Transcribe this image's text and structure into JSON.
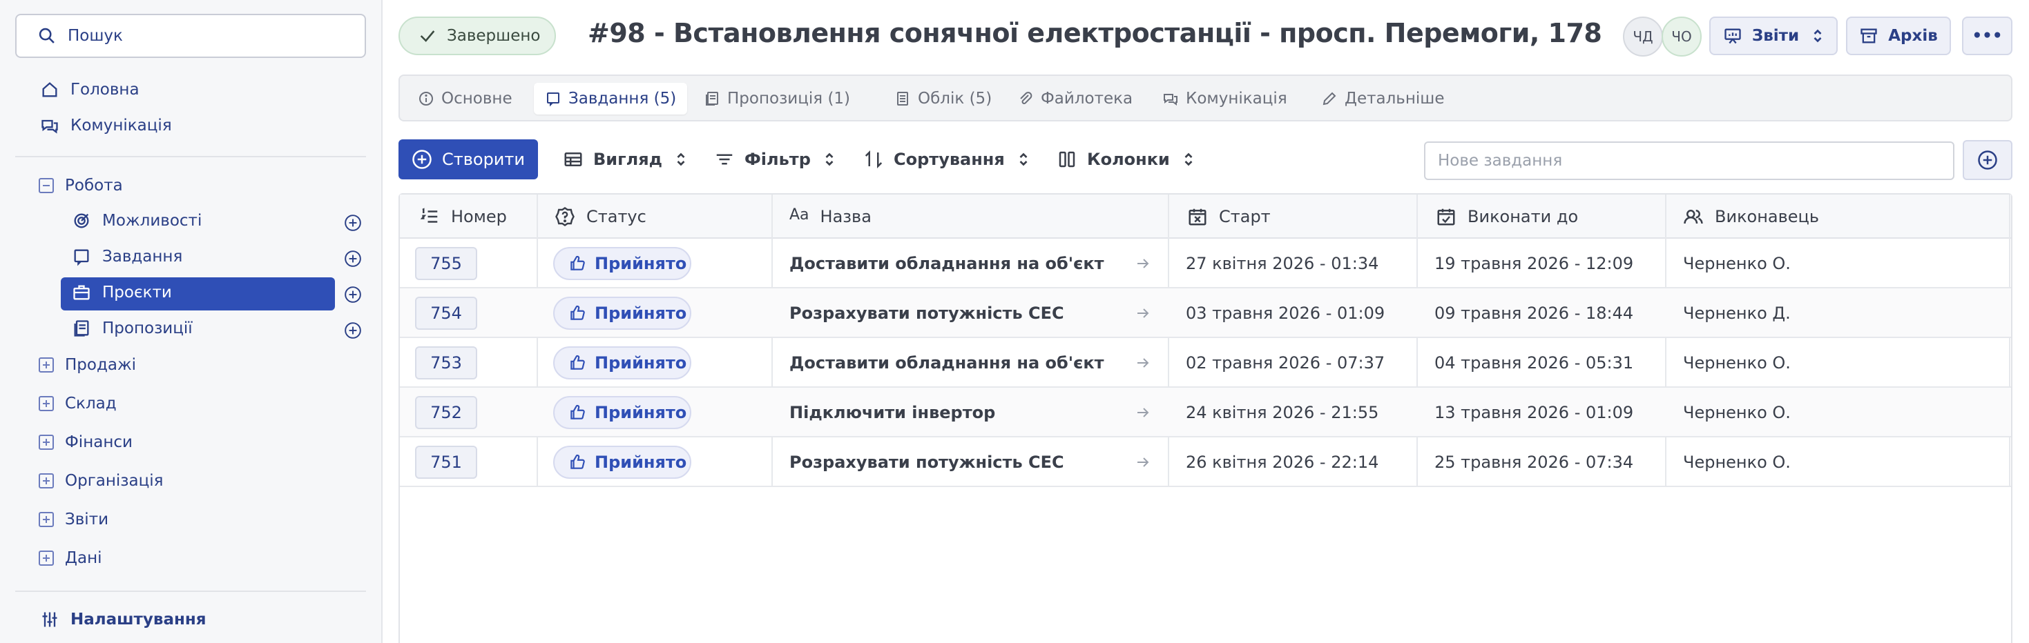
{
  "sidebar": {
    "search_label": "Пошук",
    "top_items": [
      {
        "label": "Головна",
        "icon": "home-icon"
      },
      {
        "label": "Комунікація",
        "icon": "chat-icon"
      }
    ],
    "work_group": {
      "label": "Робота",
      "items": [
        {
          "label": "Можливості",
          "icon": "target-icon"
        },
        {
          "label": "Завдання",
          "icon": "task-icon"
        },
        {
          "label": "Проєкти",
          "icon": "briefcase-icon",
          "active": true
        },
        {
          "label": "Пропозиції",
          "icon": "proposal-icon"
        }
      ]
    },
    "collapsed_groups": [
      "Продажі",
      "Склад",
      "Фінанси",
      "Організація",
      "Звіти",
      "Дані"
    ],
    "settings_label": "Налаштування"
  },
  "header": {
    "status": "Завершено",
    "title": "#98 - Встановлення сонячної електростанції - просп. Перемоги, 178",
    "avatars": [
      "ЧД",
      "ЧО"
    ],
    "reports_label": "Звіти",
    "archive_label": "Архів",
    "more_label": "•••"
  },
  "tabs": [
    {
      "label": "Основне",
      "icon": "info-icon"
    },
    {
      "label": "Завдання (5)",
      "icon": "task-icon",
      "active": true
    },
    {
      "label": "Пропозиція (1)",
      "icon": "proposal-icon"
    },
    {
      "label": "Облік (5)",
      "icon": "ledger-icon"
    },
    {
      "label": "Файлотека",
      "icon": "paperclip-icon"
    },
    {
      "label": "Комунікація",
      "icon": "chat-icon"
    },
    {
      "label": "Детальніше",
      "icon": "pencil-icon"
    }
  ],
  "toolbar": {
    "create_label": "Створити",
    "view_label": "Вигляд",
    "filter_label": "Фільтр",
    "sort_label": "Сортування",
    "columns_label": "Колонки",
    "new_task_placeholder": "Нове завдання"
  },
  "table": {
    "columns": [
      "Номер",
      "Статус",
      "Назва",
      "Старт",
      "Виконати до",
      "Виконавець"
    ],
    "rows": [
      {
        "number": "755",
        "status": "Прийнято",
        "name": "Доставити обладнання на об'єкт",
        "start": "27 квітня 2026 - 01:34",
        "due": "19 травня 2026 - 12:09",
        "assignee": "Черненко О."
      },
      {
        "number": "754",
        "status": "Прийнято",
        "name": "Розрахувати потужність СЕС",
        "start": "03 травня 2026 - 01:09",
        "due": "09 травня 2026 - 18:44",
        "assignee": "Черненко Д."
      },
      {
        "number": "753",
        "status": "Прийнято",
        "name": "Доставити обладнання на об'єкт",
        "start": "02 травня 2026 - 07:37",
        "due": "04 травня 2026 - 05:31",
        "assignee": "Черненко О."
      },
      {
        "number": "752",
        "status": "Прийнято",
        "name": "Підключити інвертор",
        "start": "24 квітня 2026 - 21:55",
        "due": "13 травня 2026 - 01:09",
        "assignee": "Черненко О."
      },
      {
        "number": "751",
        "status": "Прийнято",
        "name": "Розрахувати потужність СЕС",
        "start": "26 квітня 2026 - 22:14",
        "due": "25 травня 2026 - 07:34",
        "assignee": "Черненко О."
      }
    ]
  },
  "colors": {
    "accent": "#2f4fb6",
    "link": "#2a3f86",
    "success_bg": "#e8f3ea"
  }
}
